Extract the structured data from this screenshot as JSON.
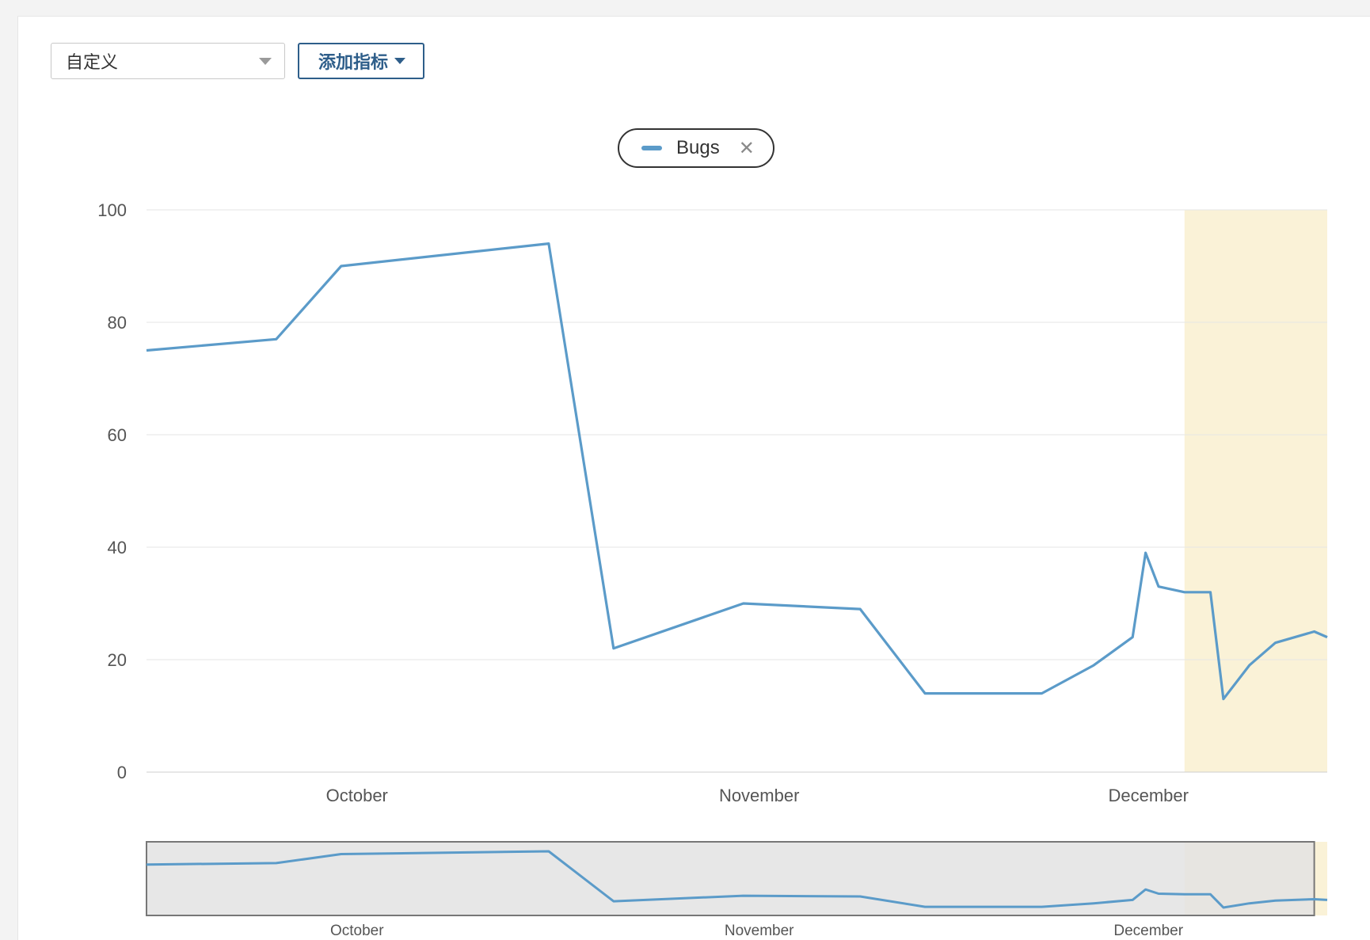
{
  "toolbar": {
    "range_select": {
      "value": "自定义"
    },
    "add_metric_label": "添加指标"
  },
  "legend": {
    "label": "Bugs"
  },
  "colors": {
    "series": "#5b9bc9",
    "highlight": "#faf2d7",
    "navigator_mask": "#e3e3e3"
  },
  "chart_data": {
    "type": "line",
    "series": [
      {
        "name": "Bugs",
        "x": [
          "2019-09-16",
          "2019-09-26",
          "2019-10-01",
          "2019-10-17",
          "2019-10-22",
          "2019-11-01",
          "2019-11-10",
          "2019-11-15",
          "2019-11-24",
          "2019-11-28",
          "2019-12-01",
          "2019-12-02",
          "2019-12-03",
          "2019-12-05",
          "2019-12-07",
          "2019-12-08",
          "2019-12-10",
          "2019-12-12",
          "2019-12-15",
          "2019-12-16"
        ],
        "y": [
          75,
          77,
          90,
          94,
          22,
          30,
          29,
          14,
          14,
          19,
          24,
          39,
          33,
          32,
          32,
          13,
          19,
          23,
          25,
          24
        ]
      }
    ],
    "ylim": [
      0,
      100
    ],
    "yticks": [
      0,
      20,
      40,
      60,
      80,
      100
    ],
    "xticks": [
      {
        "label": "October",
        "x": "2019-10-01"
      },
      {
        "label": "November",
        "x": "2019-11-01"
      },
      {
        "label": "December",
        "x": "2019-12-01"
      }
    ],
    "highlight_range": [
      "2019-12-05",
      "2019-12-16"
    ],
    "navigator": {
      "selected_range": [
        "2019-09-16",
        "2019-12-15"
      ]
    },
    "grid": true
  }
}
